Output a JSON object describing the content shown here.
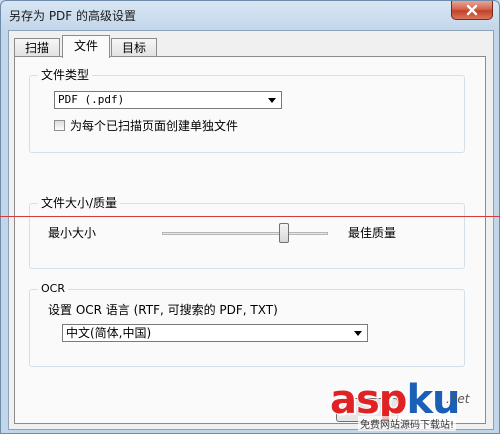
{
  "window": {
    "title": "另存为 PDF 的高级设置"
  },
  "tabs": [
    {
      "label": "扫描",
      "active": false
    },
    {
      "label": "文件",
      "active": true
    },
    {
      "label": "目标",
      "active": false
    }
  ],
  "file_type": {
    "group_label": "文件类型",
    "format_value": "PDF (.pdf)",
    "checkbox_label": "为每个已扫描页面创建单独文件",
    "checked": false
  },
  "quality": {
    "group_label": "文件大小/质量",
    "min_label": "最小大小",
    "max_label": "最佳质量",
    "level": 0.75
  },
  "ocr": {
    "group_label": "OCR",
    "setting_label": "设置 OCR 语言 (RTF, 可搜索的 PDF, TXT)",
    "language_value": "中文(简体,中国)"
  },
  "watermark": {
    "brand_red": "asp",
    "brand_blue": "ku",
    "suffix": ".net",
    "tagline": "免费网站源码下载站!"
  },
  "colors": {
    "accent_red": "#e02222",
    "accent_blue": "#1b5fb6",
    "close_red": "#c2412a"
  }
}
